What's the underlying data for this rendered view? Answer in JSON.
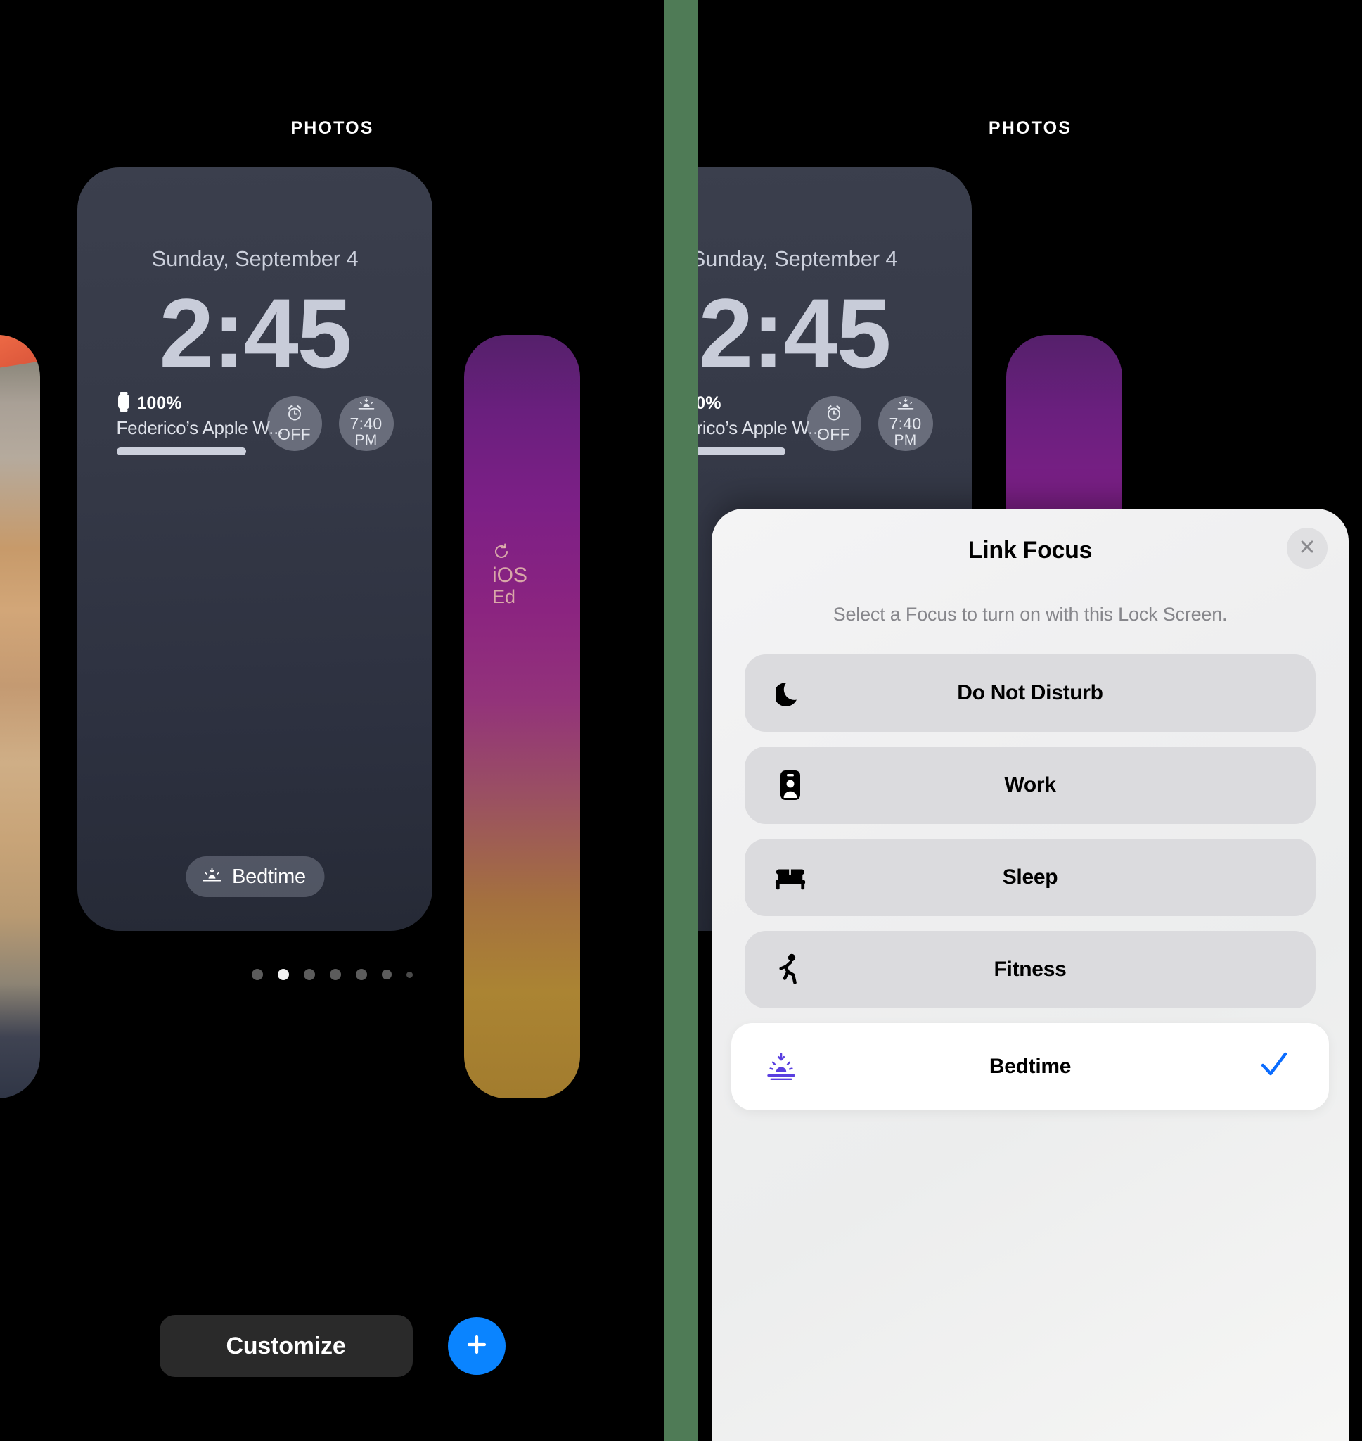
{
  "panels": {
    "left": {
      "header": "PHOTOS"
    },
    "right": {
      "header": "PHOTOS"
    }
  },
  "lock_screen": {
    "date": "Sunday, September 4",
    "time": "2:45",
    "widgets": {
      "battery": {
        "icon": "apple-watch-icon",
        "percent": "100%",
        "device_name": "Federico’s Apple W..."
      },
      "alarm": {
        "icon": "alarm-clock-icon",
        "label": "OFF"
      },
      "sunset": {
        "icon": "sunset-icon",
        "time": "7:40",
        "meridiem": "PM"
      }
    },
    "focus_pill": {
      "icon": "bedtime-icon",
      "label": "Bedtime"
    }
  },
  "thumbnails": {
    "purple": {
      "line1": "iOS",
      "line2": "Ed",
      "icon": "timer-icon"
    }
  },
  "pagination": {
    "count": 7,
    "active_index": 1
  },
  "bottom_bar": {
    "customize_label": "Customize",
    "add_icon": "plus-icon"
  },
  "sheet": {
    "title": "Link Focus",
    "close_icon": "close-icon",
    "subtitle": "Select a Focus to turn on with this Lock Screen.",
    "options": [
      {
        "label": "Do Not Disturb",
        "icon": "moon-icon",
        "selected": false
      },
      {
        "label": "Work",
        "icon": "id-badge-icon",
        "selected": false
      },
      {
        "label": "Sleep",
        "icon": "bed-icon",
        "selected": false
      },
      {
        "label": "Fitness",
        "icon": "runner-icon",
        "selected": false
      },
      {
        "label": "Bedtime",
        "icon": "bedtime-icon",
        "selected": true,
        "check_icon": "checkmark-icon"
      }
    ]
  },
  "colors": {
    "accent_blue": "#0a84ff",
    "divider_green": "#4f7b56",
    "sheet_bg": "#eeeef0",
    "selected_row_bg": "#ffffff",
    "bedtime_icon_purple": "#5a3fe0"
  }
}
